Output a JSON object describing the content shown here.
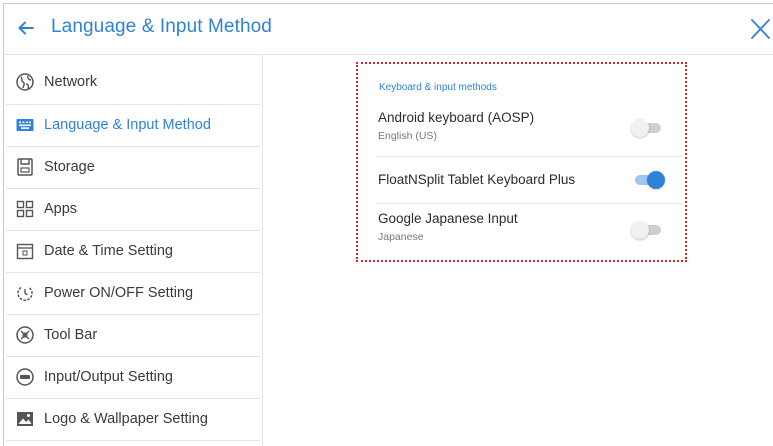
{
  "header": {
    "title": "Language & Input Method",
    "back_icon": "arrow-left-icon",
    "close_icon": "close-icon",
    "accent_color": "#2f82d8"
  },
  "sidebar": {
    "items": [
      {
        "label": "Network",
        "icon": "globe-icon",
        "active": false
      },
      {
        "label": "Language & Input Method",
        "icon": "keyboard-icon",
        "active": true
      },
      {
        "label": "Storage",
        "icon": "storage-icon",
        "active": false
      },
      {
        "label": "Apps",
        "icon": "apps-grid-icon",
        "active": false
      },
      {
        "label": "Date & Time Setting",
        "icon": "calendar-icon",
        "active": false
      },
      {
        "label": "Power ON/OFF Setting",
        "icon": "power-icon",
        "active": false
      },
      {
        "label": "Tool Bar",
        "icon": "toolbar-icon",
        "active": false
      },
      {
        "label": "Input/Output Setting",
        "icon": "input-output-icon",
        "active": false
      },
      {
        "label": "Logo & Wallpaper Setting",
        "icon": "image-icon",
        "active": false
      }
    ]
  },
  "keyboard": {
    "section_title": "Keyboard & input methods",
    "methods": [
      {
        "name": "Android keyboard (AOSP)",
        "subtitle": "English (US)",
        "enabled": false
      },
      {
        "name": "FloatNSplit Tablet Keyboard Plus",
        "subtitle": "",
        "enabled": true
      },
      {
        "name": "Google Japanese Input",
        "subtitle": "Japanese",
        "enabled": false
      }
    ]
  }
}
